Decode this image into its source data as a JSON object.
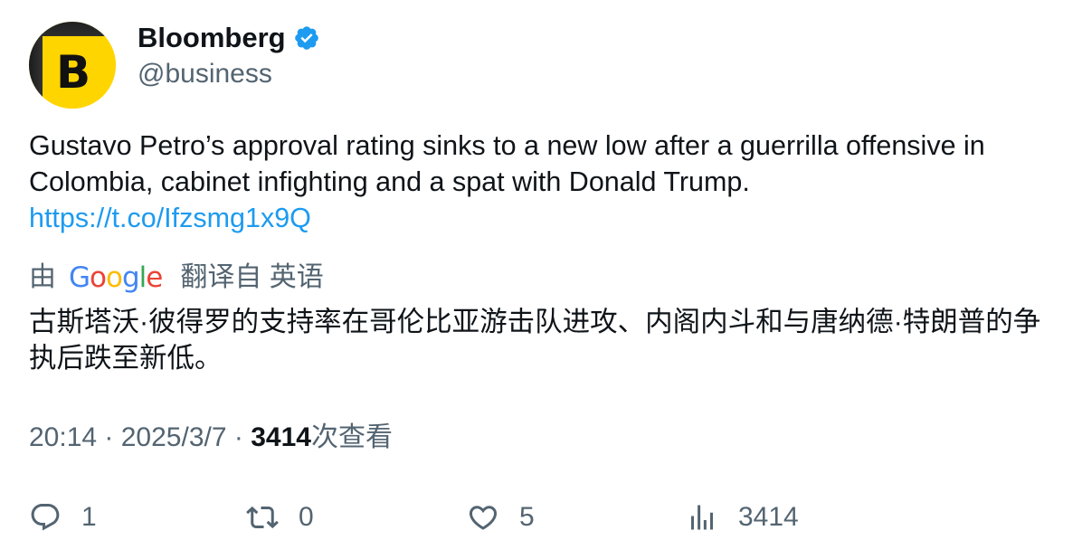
{
  "author": {
    "display_name": "Bloomberg",
    "handle": "@business",
    "avatar_letter": "B",
    "verified": true,
    "avatar_color": "#ffd500"
  },
  "tweet": {
    "text": "Gustavo Petro’s approval rating sinks to a new low after a guerrilla offensive in Colombia, cabinet infighting and a spat with Donald Trump.",
    "link": "https://t.co/Ifzsmg1x9Q"
  },
  "translation": {
    "prefix": "由",
    "provider_logo": "Google",
    "suffix": "翻译自 英语",
    "text": "古斯塔沃·彼得罗的支持率在哥伦比亚游击队进攻、内阁内斗和与唐纳德·特朗普的争执后跌至新低。"
  },
  "meta": {
    "time": "20:14",
    "separator": "·",
    "date": "2025/3/7",
    "views_count": "3414",
    "views_label": "次查看"
  },
  "actions": {
    "reply": {
      "icon": "reply-icon",
      "count": "1"
    },
    "retweet": {
      "icon": "retweet-icon",
      "count": "0"
    },
    "like": {
      "icon": "heart-icon",
      "count": "5"
    },
    "views": {
      "icon": "views-chart-icon",
      "count": "3414"
    }
  },
  "colors": {
    "link": "#1d9bf0",
    "verified": "#1d9bf0",
    "secondary_text": "#536471",
    "primary_text": "#0f1419"
  }
}
